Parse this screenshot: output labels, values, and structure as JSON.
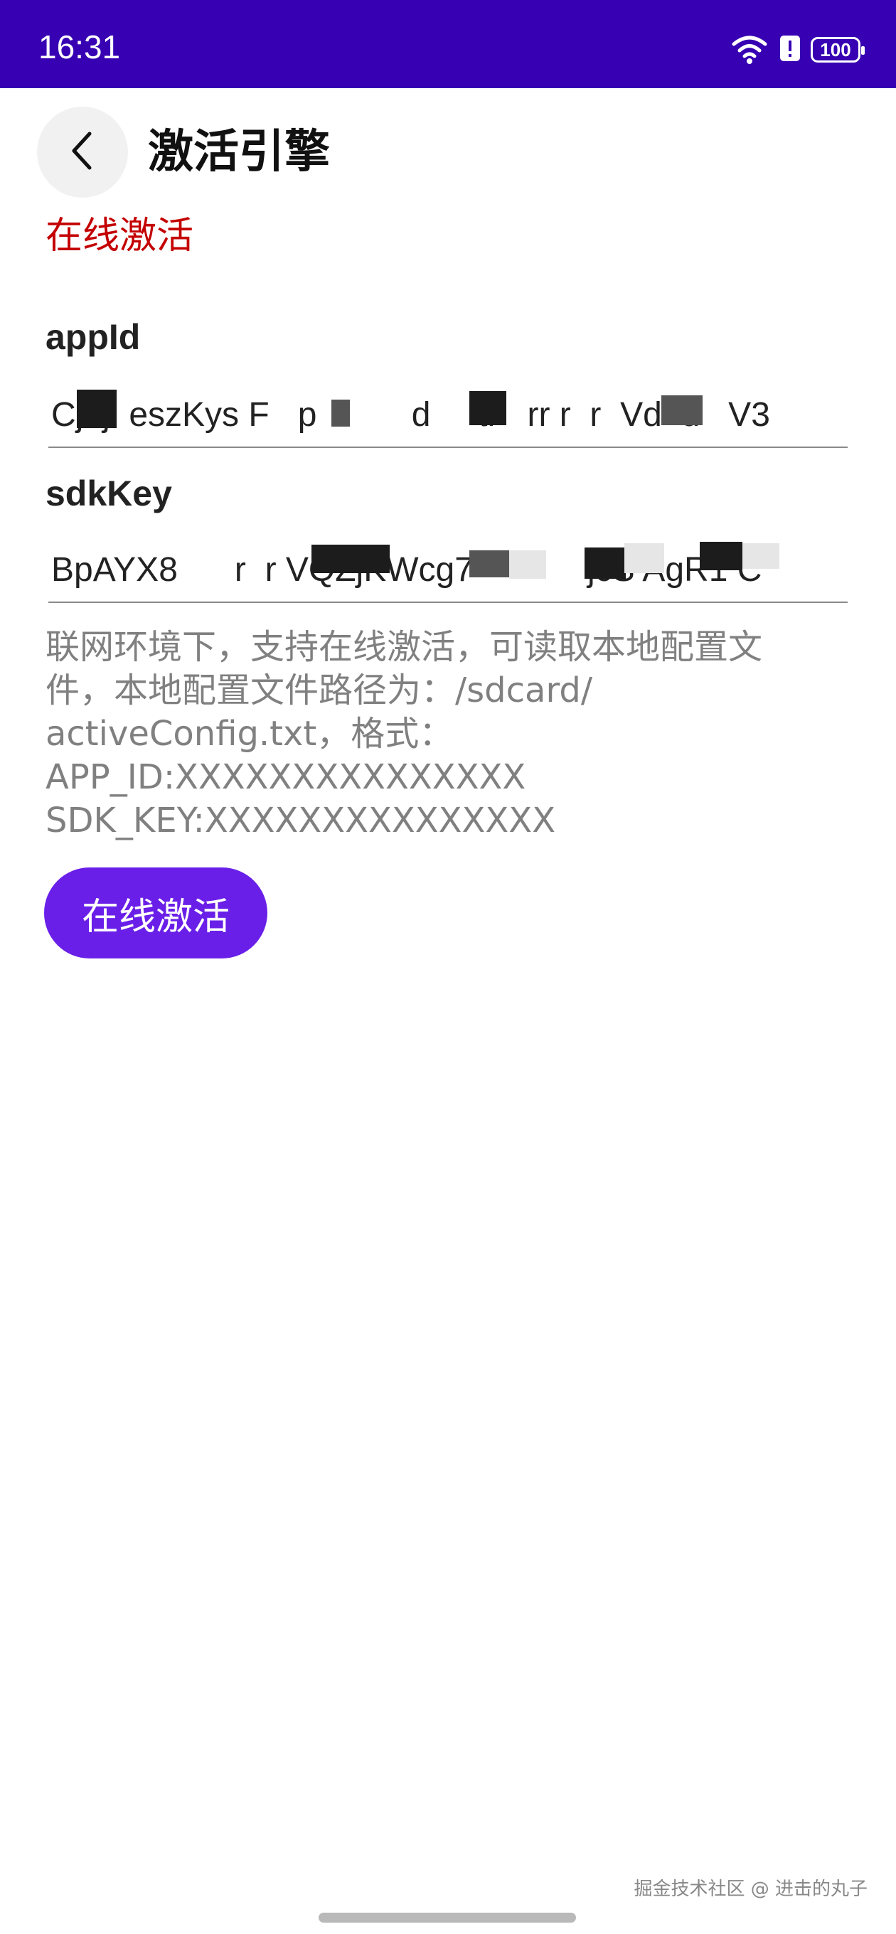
{
  "status_bar": {
    "time": "16:31",
    "battery": "100"
  },
  "header": {
    "title": "激活引擎"
  },
  "section": {
    "title": "在线激活"
  },
  "fields": {
    "app_id": {
      "label": "appId",
      "value": "Cj  j  eszKys F   p          d     tr   rr r  r  Vd  d   V3"
    },
    "sdk_key": {
      "label": "sdkKey",
      "value": "BpAYX8      r  r VQZjKWcg7            jcS AgR1 C"
    }
  },
  "hint": {
    "lines": [
      "联网环境下，支持在线激活，可读取本地配置文",
      "件，本地配置文件路径为：/sdcard/",
      "activeConfig.txt，格式：",
      "APP_ID:XXXXXXXXXXXXXXX",
      "SDK_KEY:XXXXXXXXXXXXXXX"
    ]
  },
  "button": {
    "label": "在线激活"
  },
  "watermark": "掘金技术社区 @ 进击的丸子",
  "colors": {
    "status_bar": "#3700b3",
    "accent": "#6a1fe8",
    "section_title": "#c40000"
  }
}
